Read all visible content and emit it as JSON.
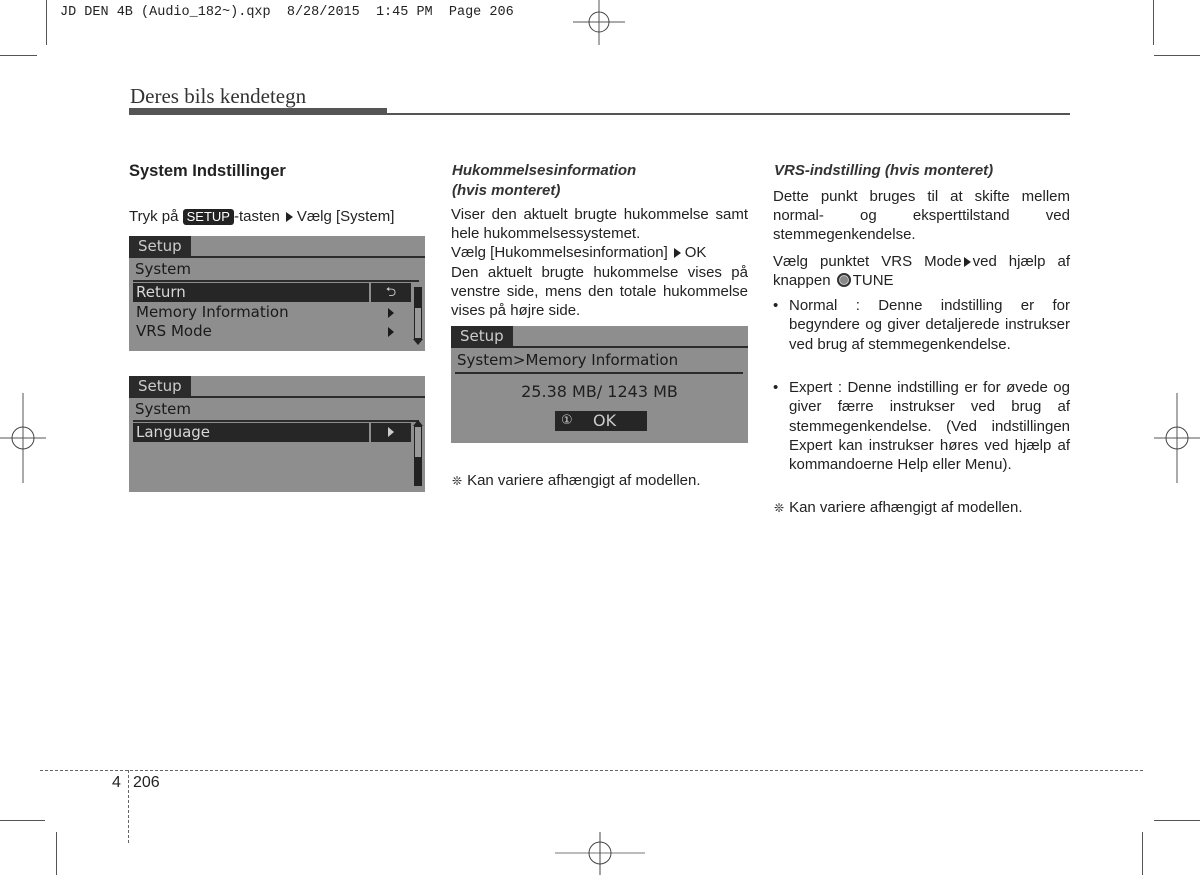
{
  "slug": "JD DEN 4B (Audio_182~).qxp  8/28/2015  1:45 PM  Page 206",
  "header": {
    "title": "Deres bils kendetegn"
  },
  "col1": {
    "heading": "System Indstillinger",
    "instruction": {
      "prefix": "Tryk på",
      "key": "SETUP",
      "mid": "-tasten",
      "suffix": "Vælg [System]"
    },
    "screen1": {
      "tab": "Setup",
      "subtitle": "System",
      "items": [
        {
          "label": "Return",
          "selected": true,
          "action": "return-icon"
        },
        {
          "label": "Memory Information",
          "selected": false,
          "action": "arrow-right"
        },
        {
          "label": "VRS Mode",
          "selected": false,
          "action": "arrow-right"
        }
      ],
      "return_glyph": "⮌"
    },
    "screen2": {
      "tab": "Setup",
      "subtitle": "System",
      "items": [
        {
          "label": "Language",
          "selected": true,
          "action": "arrow-right"
        }
      ]
    }
  },
  "col2": {
    "heading_line1": "Hukommelsesinformation",
    "heading_line2": "(hvis monteret)",
    "para1": "Viser den aktuelt brugte hukommelse samt hele hukommelsessystemet.",
    "select_prefix": "Vælg [Hukommelsesinformation]",
    "select_suffix": "OK",
    "para2": "Den aktuelt brugte hukommelse vises på venstre side, mens den totale hukommelse vises på højre side.",
    "screen": {
      "tab": "Setup",
      "subtitle": "System>Memory Information",
      "memory_value": "25.38 MB/ 1243 MB",
      "ok_icon": "①",
      "ok_label": "OK"
    },
    "note_symbol": "❊",
    "note": "Kan variere afhængigt af modellen."
  },
  "col3": {
    "heading": "VRS-indstilling (hvis monteret)",
    "para1": "Dette punkt bruges til at skifte mellem normal- og eksperttilstand ved stemmegenkendelse.",
    "select_prefix": "Vælg punktet VRS Mode",
    "select_mid": "ved hjælp af knappen",
    "select_suffix": "TUNE",
    "bullets": [
      "Normal : Denne indstilling er for begyndere og giver detaljerede instrukser ved brug af stemmegenkendelse.",
      "Expert : Denne indstilling er for øvede og giver færre instrukser ved brug af stemmegenkendelse. (Ved indstillingen Expert kan instrukser høres ved hjælp af kommandoerne Help eller Menu)."
    ],
    "bullet_symbol": "•",
    "note_symbol": "❊",
    "note": "Kan variere afhængigt af modellen."
  },
  "footer": {
    "chapter": "4",
    "page": "206"
  }
}
